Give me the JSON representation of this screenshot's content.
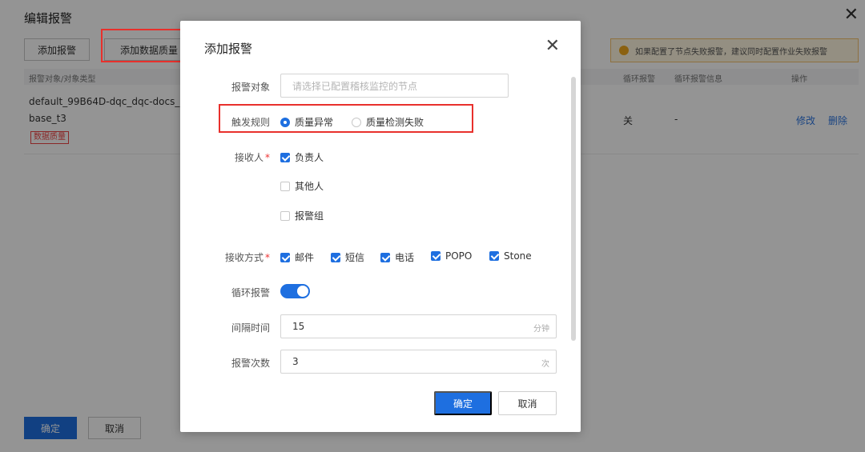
{
  "background": {
    "title": "编辑报警",
    "add_alarm_label": "添加报警",
    "add_dq_alarm_label": "添加数据质量",
    "notice": "如果配置了节点失败报警，建议同时配置作业失败报警",
    "table": {
      "headers": [
        "报警对象/对象类型",
        "循环报警",
        "循环报警信息",
        "操作"
      ],
      "row": {
        "object_line1": "default_99B64D-dqc_dqc-docs_e",
        "object_line2": "base_t3",
        "type_tag": "数据质量",
        "loop": "关",
        "loop_info": "-",
        "edit": "修改",
        "delete": "删除"
      }
    },
    "confirm_label": "确定",
    "cancel_label": "取消"
  },
  "modal": {
    "title": "添加报警",
    "target": {
      "label": "报警对象",
      "placeholder": "请选择已配置稽核监控的节点"
    },
    "trigger": {
      "label": "触发规则",
      "options": [
        "质量异常",
        "质量检测失败"
      ],
      "selected": "质量异常"
    },
    "receivers": {
      "label": "接收人",
      "options": [
        {
          "text": "负责人",
          "checked": true
        },
        {
          "text": "其他人",
          "checked": false
        },
        {
          "text": "报警组",
          "checked": false
        }
      ]
    },
    "methods": {
      "label": "接收方式",
      "options": [
        {
          "text": "邮件",
          "checked": true
        },
        {
          "text": "短信",
          "checked": true
        },
        {
          "text": "电话",
          "checked": true
        },
        {
          "text": "POPO",
          "checked": true
        },
        {
          "text": "Stone",
          "checked": true
        }
      ]
    },
    "loop_alarm": {
      "label": "循环报警",
      "enabled": true
    },
    "interval": {
      "label": "间隔时间",
      "value": "15",
      "unit": "分钟"
    },
    "count": {
      "label": "报警次数",
      "value": "3",
      "unit": "次"
    },
    "confirm_label": "确定",
    "cancel_label": "取消"
  },
  "colors": {
    "primary": "#1e6fe0",
    "highlight": "#e8302c",
    "warning": "#f0a81c"
  }
}
